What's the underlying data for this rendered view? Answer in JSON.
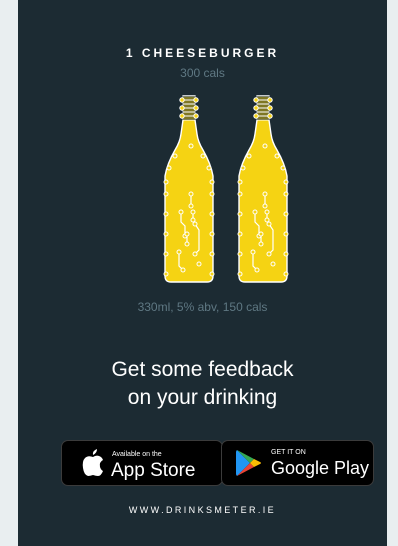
{
  "ad": {
    "headline": "1 CHEESEBURGER",
    "headline_sub": "300 cals",
    "bottle_caption": "330ml, 5% abv, 150 cals",
    "tagline_line1": "Get some feedback",
    "tagline_line2": "on your drinking",
    "website": "WWW.DRINKSMETER.IE"
  },
  "buttons": {
    "app_store": {
      "small": "Available on the",
      "big": "App Store",
      "icon": "apple-icon"
    },
    "google_play": {
      "small": "GET IT ON",
      "big": "Google Play",
      "icon": "google-play-icon"
    }
  },
  "colors": {
    "card_bg": "#1c2b33",
    "page_bg": "#e9eef0",
    "beer": "#f5d313",
    "muted_text": "#5f7883"
  }
}
